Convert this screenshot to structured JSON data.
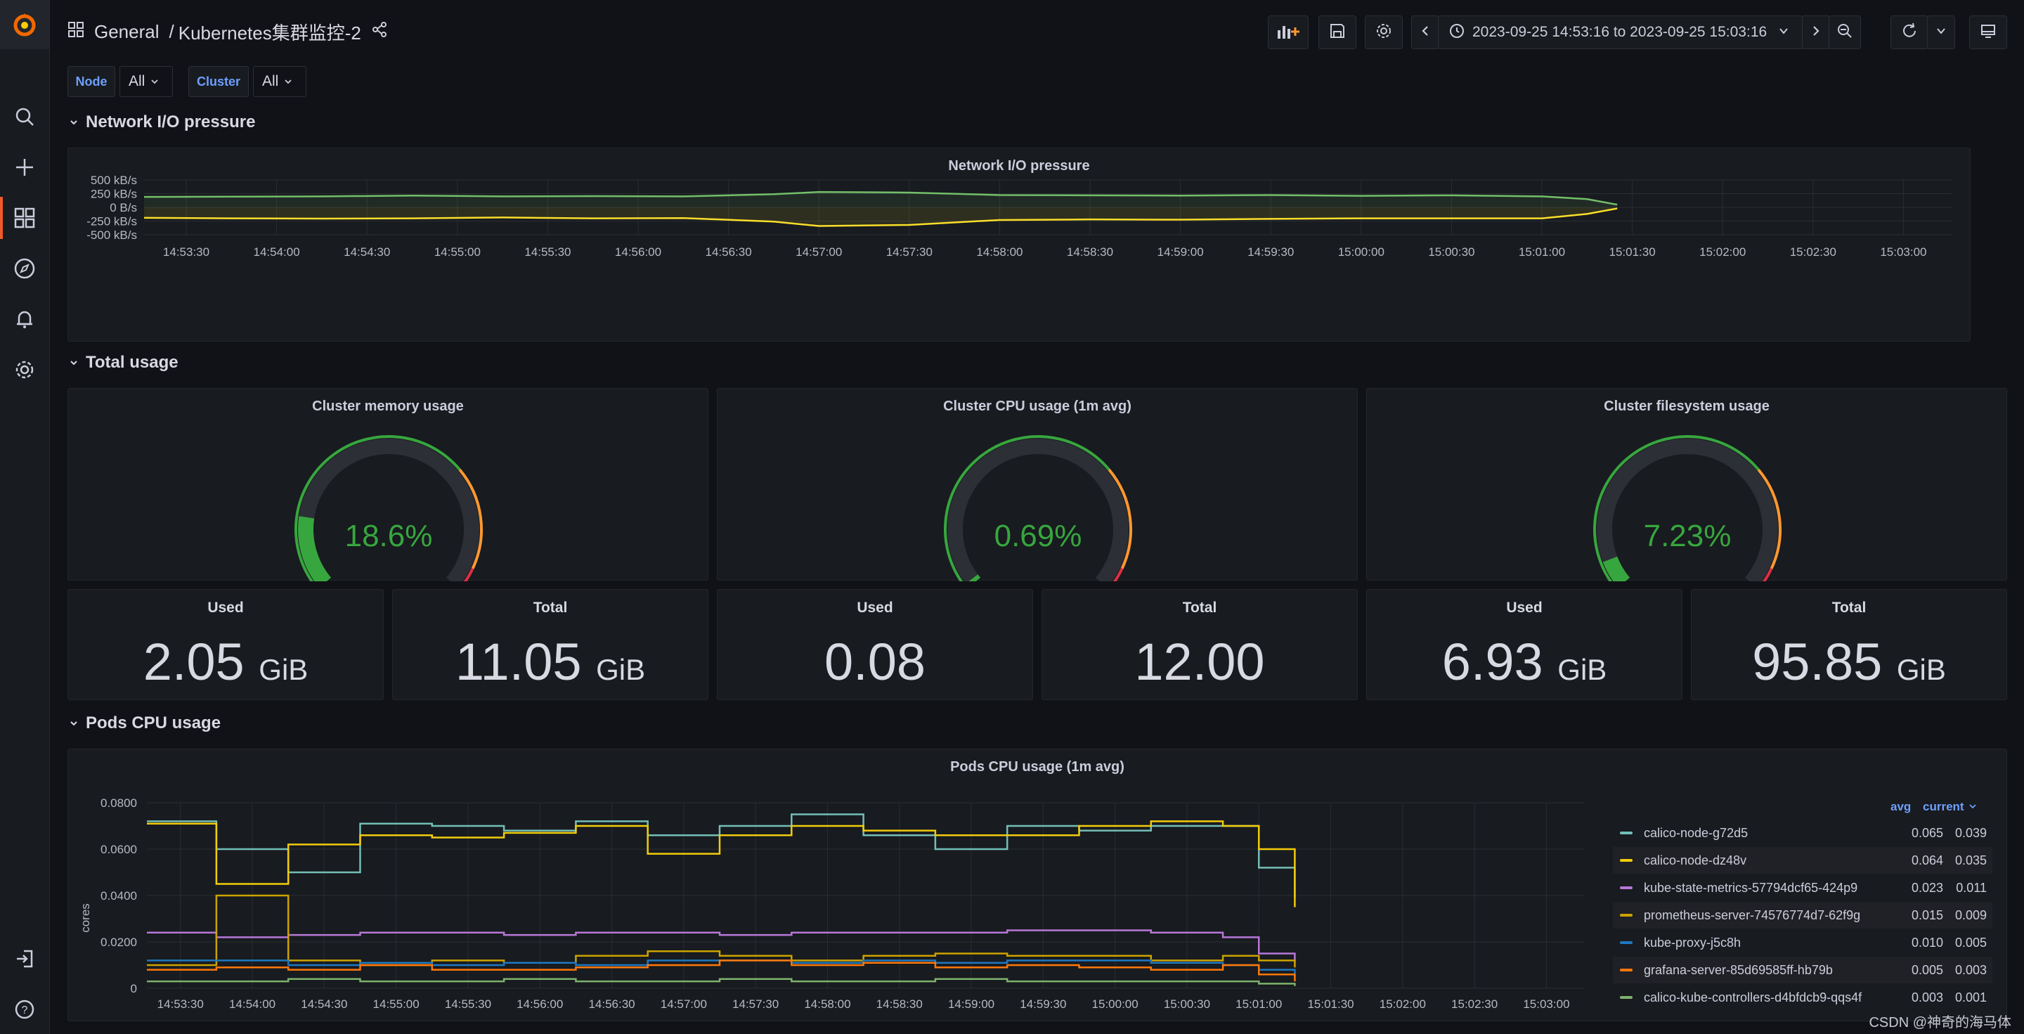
{
  "breadcrumb": {
    "folder": "General",
    "separator": "/",
    "dashboard": "Kubernetes集群监控-2"
  },
  "toolbar": {
    "time_range": "2023-09-25 14:53:16 to 2023-09-25 15:03:16"
  },
  "variables": [
    {
      "label": "Node",
      "value": "All"
    },
    {
      "label": "Cluster",
      "value": "All"
    }
  ],
  "rows": {
    "network": "Network I/O pressure",
    "total": "Total usage",
    "pods": "Pods CPU usage"
  },
  "network_panel": {
    "title": "Network I/O pressure",
    "y_ticks": [
      "500 kB/s",
      "250 kB/s",
      "0 B/s",
      "-250 kB/s",
      "-500 kB/s"
    ],
    "x_ticks": [
      "14:53:30",
      "14:54:00",
      "14:54:30",
      "14:55:00",
      "14:55:30",
      "14:56:00",
      "14:56:30",
      "14:57:00",
      "14:57:30",
      "14:58:00",
      "14:58:30",
      "14:59:00",
      "14:59:30",
      "15:00:00",
      "15:00:30",
      "15:01:00",
      "15:01:30",
      "15:02:00",
      "15:02:30",
      "15:03:00"
    ]
  },
  "gauges": [
    {
      "title": "Cluster memory usage",
      "value": "18.6%",
      "fraction": 0.186
    },
    {
      "title": "Cluster CPU usage (1m avg)",
      "value": "0.69%",
      "fraction": 0.0069
    },
    {
      "title": "Cluster filesystem usage",
      "value": "7.23%",
      "fraction": 0.0723
    }
  ],
  "stats": [
    {
      "title": "Used",
      "value": "2.05",
      "unit": "GiB"
    },
    {
      "title": "Total",
      "value": "11.05",
      "unit": "GiB"
    },
    {
      "title": "Used",
      "value": "0.08",
      "unit": ""
    },
    {
      "title": "Total",
      "value": "12.00",
      "unit": ""
    },
    {
      "title": "Used",
      "value": "6.93",
      "unit": "GiB"
    },
    {
      "title": "Total",
      "value": "95.85",
      "unit": "GiB"
    }
  ],
  "pods_panel": {
    "title": "Pods CPU usage (1m avg)",
    "ylabel": "cores",
    "y_ticks": [
      "0.0800",
      "0.0600",
      "0.0400",
      "0.0200",
      "0"
    ],
    "x_ticks": [
      "14:53:30",
      "14:54:00",
      "14:54:30",
      "14:55:00",
      "14:55:30",
      "14:56:00",
      "14:56:30",
      "14:57:00",
      "14:57:30",
      "14:58:00",
      "14:58:30",
      "14:59:00",
      "14:59:30",
      "15:00:00",
      "15:00:30",
      "15:01:00",
      "15:01:30",
      "15:02:00",
      "15:02:30",
      "15:03:00"
    ],
    "legend_headers": {
      "avg": "avg",
      "current": "current"
    },
    "legend": [
      {
        "name": "calico-node-g72d5",
        "color": "#73bfb8",
        "avg": "0.065",
        "current": "0.039"
      },
      {
        "name": "calico-node-dz48v",
        "color": "#f2cc0c",
        "avg": "0.064",
        "current": "0.035"
      },
      {
        "name": "kube-state-metrics-57794dcf65-424p9",
        "color": "#b877d9",
        "avg": "0.023",
        "current": "0.011"
      },
      {
        "name": "prometheus-server-74576774d7-62f9g",
        "color": "#cca300",
        "avg": "0.015",
        "current": "0.009"
      },
      {
        "name": "kube-proxy-j5c8h",
        "color": "#1f78c1",
        "avg": "0.010",
        "current": "0.005"
      },
      {
        "name": "grafana-server-85d69585ff-hb79b",
        "color": "#ff780a",
        "avg": "0.005",
        "current": "0.003"
      },
      {
        "name": "calico-kube-controllers-d4bfdcb9-qqs4f",
        "color": "#7eb26d",
        "avg": "0.003",
        "current": "0.001"
      }
    ]
  },
  "chart_data": [
    {
      "type": "area",
      "title": "Network I/O pressure",
      "x": [
        "14:53:16",
        "14:53:45",
        "14:54:15",
        "14:54:45",
        "14:55:15",
        "14:55:45",
        "14:56:15",
        "14:56:45",
        "14:57:00",
        "14:57:30",
        "14:58:00",
        "14:58:30",
        "14:59:00",
        "14:59:30",
        "15:00:00",
        "15:00:30",
        "15:01:00",
        "15:01:15",
        "15:01:25"
      ],
      "series": [
        {
          "name": "received",
          "values": [
            190,
            195,
            200,
            215,
            200,
            205,
            200,
            240,
            280,
            270,
            225,
            220,
            215,
            225,
            210,
            220,
            200,
            150,
            50
          ]
        },
        {
          "name": "transmitted",
          "values": [
            -190,
            -200,
            -205,
            -200,
            -185,
            -200,
            -195,
            -260,
            -340,
            -320,
            -230,
            -220,
            -225,
            -210,
            -200,
            -200,
            -200,
            -120,
            -20
          ]
        }
      ],
      "ylim": [
        -500,
        500
      ]
    },
    {
      "type": "line",
      "title": "Pods CPU usage (1m avg)",
      "ylabel": "cores",
      "x": [
        "14:53:16",
        "14:53:45",
        "14:54:15",
        "14:54:45",
        "14:55:15",
        "14:55:45",
        "14:56:15",
        "14:56:45",
        "14:57:15",
        "14:57:45",
        "14:58:15",
        "14:58:45",
        "14:59:15",
        "14:59:45",
        "15:00:15",
        "15:00:45",
        "15:01:00",
        "15:01:15"
      ],
      "series": [
        {
          "name": "calico-node-g72d5",
          "values": [
            0.072,
            0.06,
            0.05,
            0.071,
            0.07,
            0.068,
            0.072,
            0.066,
            0.07,
            0.075,
            0.066,
            0.06,
            0.07,
            0.068,
            0.07,
            0.07,
            0.052,
            0.039
          ]
        },
        {
          "name": "calico-node-dz48v",
          "values": [
            0.071,
            0.045,
            0.062,
            0.066,
            0.065,
            0.067,
            0.07,
            0.058,
            0.066,
            0.07,
            0.068,
            0.066,
            0.066,
            0.07,
            0.072,
            0.07,
            0.06,
            0.035
          ]
        },
        {
          "name": "kube-state-metrics-57794dcf65-424p9",
          "values": [
            0.024,
            0.022,
            0.023,
            0.024,
            0.024,
            0.023,
            0.024,
            0.024,
            0.023,
            0.024,
            0.024,
            0.024,
            0.025,
            0.025,
            0.024,
            0.022,
            0.015,
            0.011
          ]
        },
        {
          "name": "prometheus-server-74576774d7-62f9g",
          "values": [
            0.01,
            0.04,
            0.012,
            0.01,
            0.012,
            0.011,
            0.014,
            0.016,
            0.014,
            0.012,
            0.014,
            0.015,
            0.014,
            0.014,
            0.012,
            0.014,
            0.012,
            0.009
          ]
        },
        {
          "name": "kube-proxy-j5c8h",
          "values": [
            0.012,
            0.012,
            0.01,
            0.011,
            0.01,
            0.011,
            0.01,
            0.012,
            0.012,
            0.011,
            0.012,
            0.011,
            0.012,
            0.012,
            0.011,
            0.01,
            0.008,
            0.005
          ]
        },
        {
          "name": "grafana-server-85d69585ff-hb79b",
          "values": [
            0.008,
            0.009,
            0.008,
            0.01,
            0.008,
            0.008,
            0.009,
            0.01,
            0.012,
            0.01,
            0.011,
            0.009,
            0.01,
            0.009,
            0.008,
            0.01,
            0.006,
            0.003
          ]
        },
        {
          "name": "calico-kube-controllers-d4bfdcb9-qqs4f",
          "values": [
            0.003,
            0.003,
            0.004,
            0.003,
            0.003,
            0.004,
            0.003,
            0.003,
            0.004,
            0.003,
            0.003,
            0.004,
            0.003,
            0.003,
            0.003,
            0.003,
            0.002,
            0.001
          ]
        }
      ],
      "ylim": [
        0,
        0.08
      ]
    }
  ],
  "watermark": "CSDN @神奇的海马体",
  "colors": {
    "gauge_green": "#37a63e",
    "accent": "#f05a28",
    "link_blue": "#6e9fff"
  }
}
